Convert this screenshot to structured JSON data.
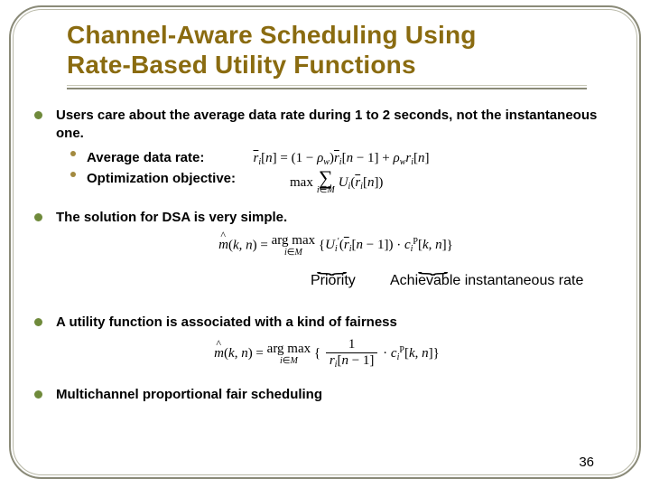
{
  "title_line1": "Channel-Aware Scheduling Using",
  "title_line2": "Rate-Based Utility Functions",
  "bullets": {
    "b1": "Users care about the average data rate during 1 to 2 seconds, not the instantaneous one.",
    "b1_sub1_label": "Average data rate:",
    "b1_sub1_eq": "r̄ᵢ[n] = (1 − ρ_w) r̄ᵢ[n − 1] + ρ_w rᵢ[n]",
    "b1_sub2_label": "Optimization objective:",
    "b1_sub2_eq_prefix": "max",
    "b1_sub2_eq_sum_range": "i ∈ 𝓜",
    "b1_sub2_eq_body": "Uᵢ( r̄ᵢ[n] )",
    "b2": "The solution for DSA is very simple.",
    "b2_eq": "m̂(k, n) = arg max_{i ∈ 𝓜} { Uᵢ′( r̄ᵢ[n − 1] ) · cᵢᴾ[k, n] }",
    "b2_priority_label": "Priority",
    "b2_rate_label": "Achievable instantaneous rate",
    "b3": "A utility function is associated with a kind of fairness",
    "b3_eq": "m̂(k, n) = arg max_{i ∈ 𝓜} { (1 / r̄ᵢ[n − 1]) · cᵢᴾ[k, n] }",
    "b4": "Multichannel proportional fair scheduling"
  },
  "page_number": "36"
}
